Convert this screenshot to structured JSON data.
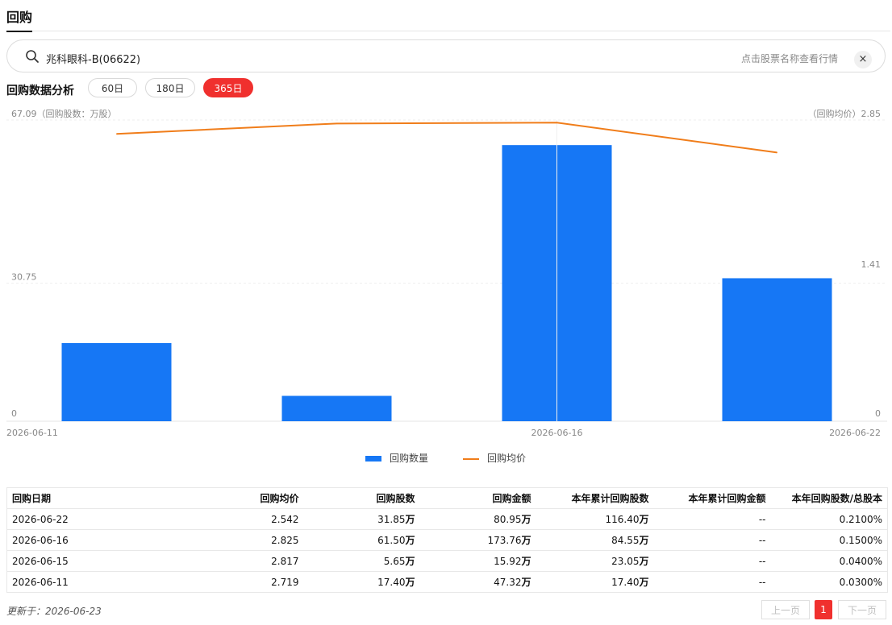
{
  "header": {
    "title": "回购"
  },
  "search": {
    "value": "兆科眼科-B(06622)",
    "placeholder": "点击股票名称查看行情",
    "clear_label": "×"
  },
  "analysis": {
    "label": "回购数据分析",
    "ranges": [
      "60日",
      "180日",
      "365日"
    ],
    "active_range": "365日"
  },
  "colors": {
    "bar": "#1677f5",
    "line": "#f07d1a",
    "accent": "#f0302e"
  },
  "chart_data": {
    "type": "bar+line",
    "left_axis_title": "67.09（回购股数：万股）",
    "right_axis_title": "（回购均价）2.85",
    "left_ticks": [
      "30.75",
      "0"
    ],
    "right_ticks": [
      "1.41",
      "0"
    ],
    "left_max": 67.09,
    "right_max": 2.85,
    "categories": [
      "2026-06-11",
      "2026-06-15",
      "2026-06-16",
      "2026-06-22"
    ],
    "x_tick_labels": [
      "2026-06-11",
      "2026-06-16",
      "2026-06-22"
    ],
    "series": [
      {
        "name": "回购数量",
        "type": "bar",
        "values": [
          17.4,
          5.65,
          61.5,
          31.85
        ]
      },
      {
        "name": "回购均价",
        "type": "line",
        "values": [
          2.719,
          2.817,
          2.825,
          2.542
        ]
      }
    ],
    "legend": [
      "回购数量",
      "回购均价"
    ],
    "legend_position": "bottom-center"
  },
  "table": {
    "headers": [
      "回购日期",
      "回购均价",
      "回购股数",
      "回购金额",
      "本年累计回购股数",
      "本年累计回购金额",
      "本年回购股数/总股本"
    ],
    "rows": [
      {
        "date": "2026-06-22",
        "price": "2.542",
        "shares": "31.85",
        "amount": "80.95",
        "ytd_shares": "116.40",
        "ytd_amount": "--",
        "ratio": "0.2100%"
      },
      {
        "date": "2026-06-16",
        "price": "2.825",
        "shares": "61.50",
        "amount": "173.76",
        "ytd_shares": "84.55",
        "ytd_amount": "--",
        "ratio": "0.1500%"
      },
      {
        "date": "2026-06-15",
        "price": "2.817",
        "shares": "5.65",
        "amount": "15.92",
        "ytd_shares": "23.05",
        "ytd_amount": "--",
        "ratio": "0.0400%"
      },
      {
        "date": "2026-06-11",
        "price": "2.719",
        "shares": "17.40",
        "amount": "47.32",
        "ytd_shares": "17.40",
        "ytd_amount": "--",
        "ratio": "0.0300%"
      }
    ],
    "unit": "万"
  },
  "footer": {
    "updated": "更新于：2026-06-23",
    "prev": "上一页",
    "page": "1",
    "next": "下一页"
  }
}
